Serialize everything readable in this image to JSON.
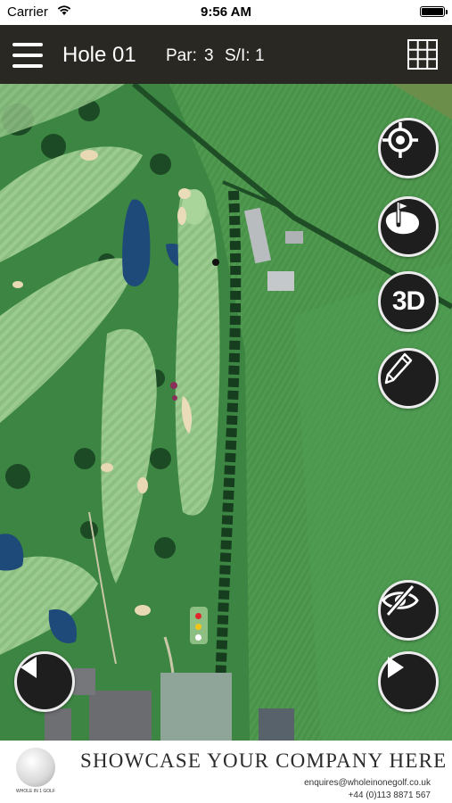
{
  "status_bar": {
    "carrier": "Carrier",
    "time": "9:56 AM"
  },
  "header": {
    "hole_title": "Hole 01",
    "par_label": "Par:",
    "par_value": "3",
    "si_label": "S/I:",
    "si_value": "1"
  },
  "map_controls": {
    "right_top": [
      "locate-icon",
      "green-flag-icon",
      "3d-icon",
      "pencil-icon"
    ],
    "three_d_label": "3D",
    "right_bottom": [
      "hide-icon",
      "next-arrow-icon"
    ],
    "left_bottom": [
      "previous-arrow-icon"
    ]
  },
  "tee_markers": {
    "colors": [
      "#e0262b",
      "#f2c418",
      "#ffffff"
    ]
  },
  "colors": {
    "header_bg": "#2a2822",
    "map_grass": "#3f8a45",
    "button_bg": "#1e1e1e",
    "button_border": "#ececec"
  },
  "footer_ad": {
    "logo_text": "WHOLE IN 1 GOLF",
    "headline": "SHOWCASE YOUR COMPANY HERE",
    "email": "enquires@wholeinonegolf.co.uk",
    "phone": "+44 (0)113 8871 567"
  }
}
